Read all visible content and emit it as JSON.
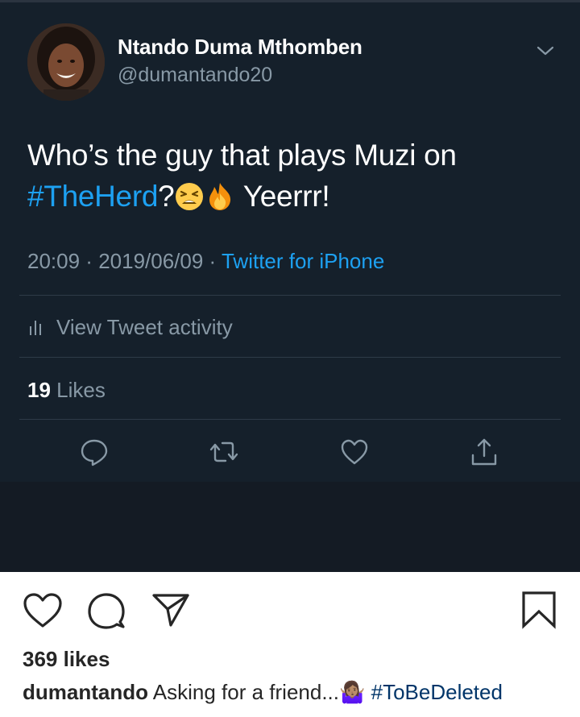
{
  "tweet": {
    "author_name": "Ntando Duma Mthomben",
    "author_handle": "@dumantando20",
    "text_line1": "Who’s the guy that plays Muzi on",
    "hashtag": "#TheHerd",
    "text_after_hashtag": "?",
    "text_end": " Yeerrr!",
    "emojis": [
      "weary-face-emoji",
      "fire-emoji"
    ],
    "time": "20:09",
    "date": "2019/06/09",
    "separator": " · ",
    "source": "Twitter for iPhone",
    "activity_label": "View Tweet activity",
    "likes_count": "19",
    "likes_label": " Likes",
    "colors": {
      "background": "#15202b",
      "link": "#1da1f2",
      "muted": "#8899a6"
    },
    "actions": [
      "reply-icon",
      "retweet-icon",
      "like-icon",
      "share-icon"
    ]
  },
  "post": {
    "likes": "369 likes",
    "username": "dumantando",
    "caption": " Asking for a friend...🤷🏽‍♀️ ",
    "hashtag": "#ToBeDeleted",
    "actions": [
      "heart-icon",
      "comment-icon",
      "send-icon",
      "bookmark-icon"
    ]
  }
}
